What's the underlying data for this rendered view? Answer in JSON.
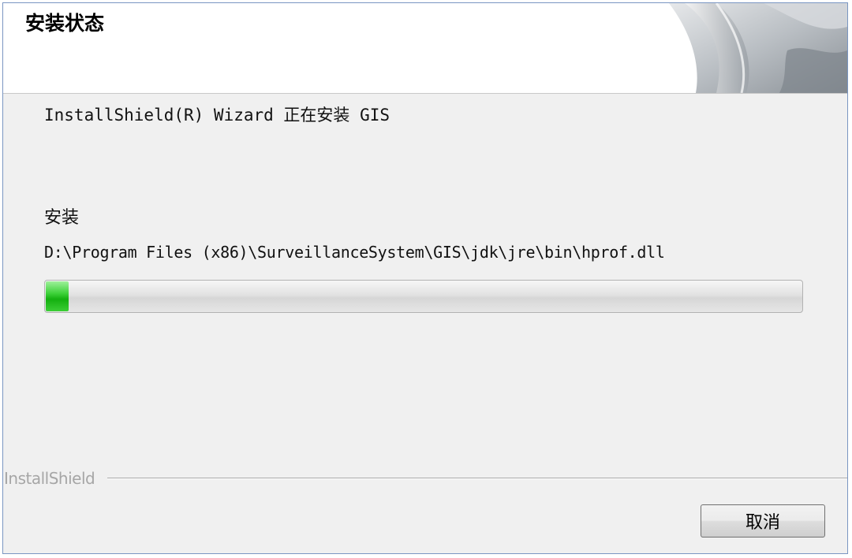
{
  "header": {
    "title": "安装状态",
    "art_icon": "installshield-page-curl-art"
  },
  "main": {
    "status_message": "InstallShield(R) Wizard 正在安装 GIS",
    "section_label": "安装",
    "current_file": "D:\\Program Files (x86)\\SurveillanceSystem\\GIS\\jdk\\jre\\bin\\hprof.dll",
    "progress_percent": 3
  },
  "footer": {
    "brand": "InstallShield",
    "cancel_label": "取消"
  },
  "colors": {
    "progress_green": "#22c01e",
    "frame_border": "#7a96c2",
    "dialog_bg": "#f0f0f0"
  }
}
